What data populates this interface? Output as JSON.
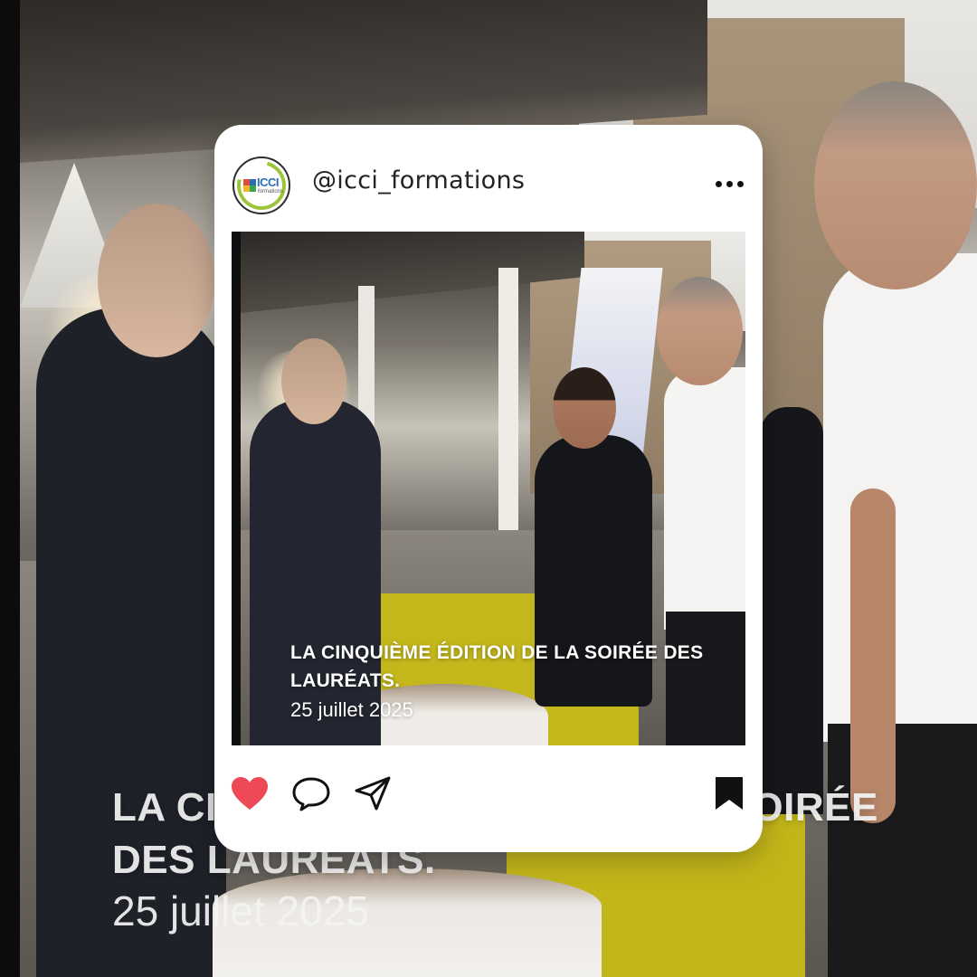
{
  "background": {
    "headline": "LA CINQUIÈME ÉDITION DE LA SOIRÉE DES LAURÉATS.",
    "date": "25 juillet 2025"
  },
  "post": {
    "account": {
      "username": "@icci_formations",
      "avatar_logo_text": "ICCI",
      "avatar_logo_subtext": "formations"
    },
    "caption": {
      "title": "LA CINQUIÈME ÉDITION DE LA SOIRÉE DES LAURÉATS.",
      "date": "25 juillet 2025"
    },
    "actions": {
      "like_icon": "heart-icon",
      "comment_icon": "comment-icon",
      "share_icon": "send-icon",
      "save_icon": "bookmark-icon",
      "liked": true
    },
    "more_icon": "more-horizontal-icon"
  },
  "colors": {
    "like_red": "#ed4956",
    "card_bg": "#ffffff",
    "text_dark": "#232323",
    "table_yellow": "#c4b71c"
  }
}
